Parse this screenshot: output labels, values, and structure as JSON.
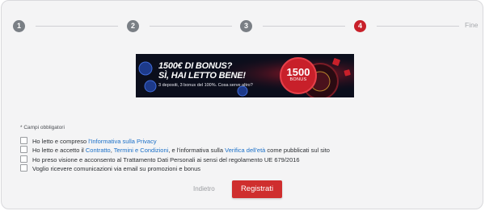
{
  "stepper": {
    "steps": [
      "1",
      "2",
      "3",
      "4"
    ],
    "end_label": "Fine",
    "active_index": 3,
    "colors": {
      "inactive": "#7a7f85",
      "active": "#c8202a"
    }
  },
  "banner": {
    "line1": "1500€ DI BONUS?",
    "line2": "SÌ, HAI LETTO BENE!",
    "small": "3 depositi, 3 bonus del 100%. Cosa serve altro?",
    "badge_value": "1500",
    "badge_label": "BONUS"
  },
  "form": {
    "required_note": "* Campi obbligatori",
    "consents": [
      {
        "parts": [
          {
            "text": "Ho letto e compreso ",
            "link": false
          },
          {
            "text": "l'Informativa sulla Privacy",
            "link": true
          }
        ]
      },
      {
        "parts": [
          {
            "text": "Ho letto e accetto il ",
            "link": false
          },
          {
            "text": "Contratto",
            "link": true
          },
          {
            "text": ", ",
            "link": false
          },
          {
            "text": "Termini e Condizioni",
            "link": true
          },
          {
            "text": ", e l'informativa sulla ",
            "link": false
          },
          {
            "text": "Verifica dell'età",
            "link": true
          },
          {
            "text": " come pubblicati sul sito",
            "link": false
          }
        ]
      },
      {
        "parts": [
          {
            "text": "Ho preso visione e acconsento al Trattamento Dati Personali ai sensi del regolamento UE 679/2016",
            "link": false
          }
        ]
      },
      {
        "parts": [
          {
            "text": "Voglio ricevere comunicazioni via email su promozioni e bonus",
            "link": false
          }
        ]
      }
    ]
  },
  "actions": {
    "back_label": "Indietro",
    "submit_label": "Registrati",
    "submit_color": "#cf2e2e"
  }
}
